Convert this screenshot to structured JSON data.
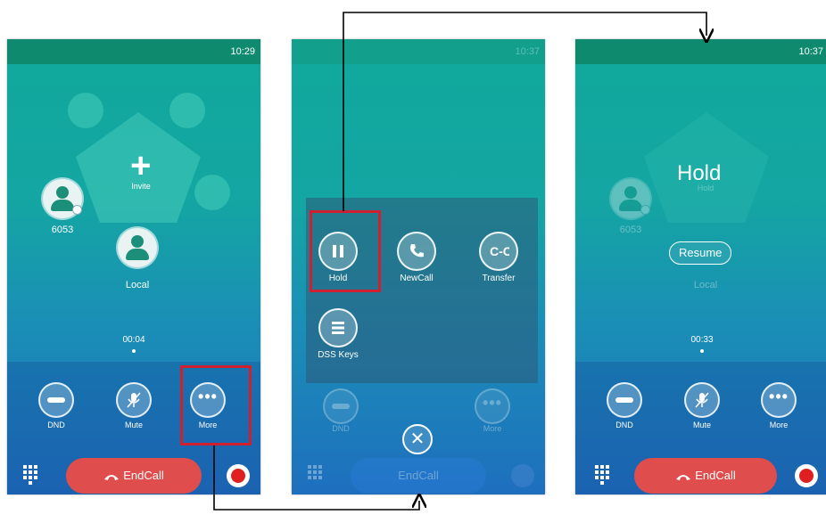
{
  "phone1": {
    "time": "10:29",
    "invite_label": "Invite",
    "contact1_label": "6053",
    "contact2_label": "Local",
    "duration": "00:04",
    "dnd_label": "DND",
    "mute_label": "Mute",
    "more_label": "More",
    "endcall_label": "EndCall"
  },
  "phone2": {
    "time": "10:37",
    "hold_label": "Hold",
    "newcall_label": "NewCall",
    "transfer_label": "Transfer",
    "dsskeys_label": "DSS Keys",
    "endcall_label": "EndCall",
    "dnd_label": "DND",
    "more_label": "More"
  },
  "phone3": {
    "time": "10:37",
    "hold_title": "Hold",
    "hold_sub": "Hold",
    "contact1_label": "6053",
    "contact2_label": "Local",
    "resume_label": "Resume",
    "duration": "00:33",
    "dnd_label": "DND",
    "mute_label": "Mute",
    "more_label": "More",
    "endcall_label": "EndCall"
  },
  "colors": {
    "highlight": "#d01f2f",
    "endcall": "#e04d4d",
    "status_bar": "#0e8a6e"
  }
}
